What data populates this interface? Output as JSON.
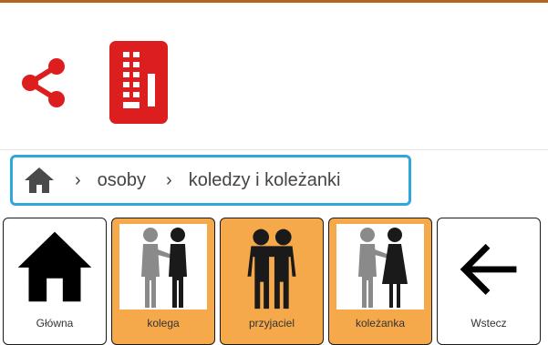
{
  "toolbar": {
    "share_icon": "share-icon",
    "app_icon": "communicator-icon",
    "accent": "#dc1e1e"
  },
  "breadcrumb": {
    "home_icon": "home-icon",
    "items": [
      "osoby",
      "koledzy i koleżanki"
    ],
    "border_color": "#2fa6dc"
  },
  "tiles": [
    {
      "label": "Główna",
      "icon": "home-icon",
      "style": "white"
    },
    {
      "label": "kolega",
      "icon": "colleague-icon",
      "style": "orange"
    },
    {
      "label": "przyjaciel",
      "icon": "friends-icon",
      "style": "orange"
    },
    {
      "label": "koleżanka",
      "icon": "female-colleague-icon",
      "style": "orange"
    },
    {
      "label": "Wstecz",
      "icon": "back-arrow-icon",
      "style": "white"
    }
  ],
  "colors": {
    "tile_orange": "#f6a94a",
    "top_line": "#b5651d"
  }
}
